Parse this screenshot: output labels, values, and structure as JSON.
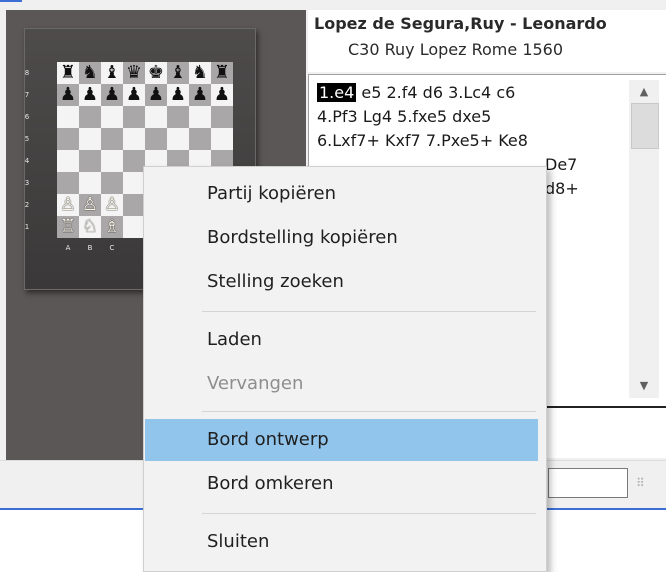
{
  "window": {
    "accent_color": "#3c6fd6",
    "board_panel_bg": "#5b5757"
  },
  "board": {
    "rank_labels": [
      "8",
      "7",
      "6",
      "5",
      "4",
      "3",
      "2",
      "1"
    ],
    "file_labels": [
      "A",
      "B",
      "C"
    ],
    "rows": [
      [
        "♜",
        "♞",
        "♝",
        "♛",
        "♚",
        "♝",
        "♞",
        "♜"
      ],
      [
        "♟",
        "♟",
        "♟",
        "♟",
        "♟",
        "♟",
        "♟",
        "♟"
      ],
      [
        "",
        "",
        "",
        "",
        "",
        "",
        "",
        ""
      ],
      [
        "",
        "",
        "",
        "",
        "",
        "",
        "",
        ""
      ],
      [
        "",
        "",
        "",
        "",
        "",
        "",
        "",
        ""
      ],
      [
        "",
        "",
        "",
        "",
        "",
        "",
        "",
        ""
      ],
      [
        "♙",
        "♙",
        "♙",
        "",
        "",
        "",
        "",
        ""
      ],
      [
        "♖",
        "♘",
        "♗",
        "",
        "",
        "",
        "",
        ""
      ]
    ]
  },
  "game": {
    "players": "Lopez de Segura,Ruy - Leonardo",
    "info": "C30 Ruy Lopez Rome 1560",
    "current_move": "1.e4",
    "move_lines": [
      " e5  2.f4  d6  3.Lc4  c6",
      "4.Pf3  Lg4  5.fxe5  dxe5",
      "6.Lxf7+  Kxf7  7.Pxe5+  Ke8",
      "De7",
      "d8+"
    ]
  },
  "scrollbar": {
    "up_icon": "▲",
    "down_icon": "▼"
  },
  "status": {
    "grip_icon": "⠿"
  },
  "context_menu": {
    "items": [
      {
        "label": "Partij kopiëren",
        "enabled": true
      },
      {
        "label": "Bordstelling kopiëren",
        "enabled": true
      },
      {
        "label": "Stelling zoeken",
        "enabled": true
      },
      {
        "label": "Laden",
        "enabled": true
      },
      {
        "label": "Vervangen",
        "enabled": false
      },
      {
        "label": "Bord ontwerp",
        "enabled": true,
        "highlighted": true
      },
      {
        "label": "Bord omkeren",
        "enabled": true
      },
      {
        "label": "Sluiten",
        "enabled": true
      }
    ],
    "highlight_color": "#92c5ec"
  }
}
